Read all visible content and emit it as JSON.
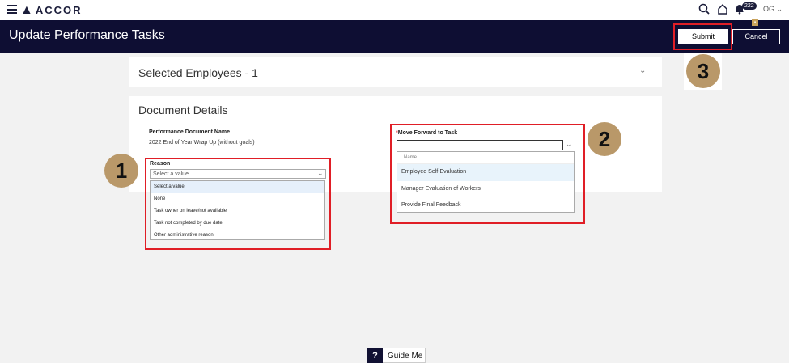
{
  "topbar": {
    "brand": "ACCOR",
    "notification_count": "222",
    "user_initials": "OG"
  },
  "header": {
    "title": "Update Performance Tasks",
    "submit_label": "Submit",
    "cancel_label": "Cancel"
  },
  "steps": [
    "1",
    "2",
    "3"
  ],
  "selected_employees": {
    "title": "Selected Employees - 1"
  },
  "document_details": {
    "title": "Document Details",
    "doc_name_label": "Performance Document Name",
    "doc_name_value": "2022 End of Year Wrap Up (without goals)",
    "reason": {
      "label": "Reason",
      "placeholder": "Select a value",
      "options": [
        "Select a value",
        "None",
        "Task owner on leave/not available",
        "Task not completed by due date",
        "Other administrative reason"
      ]
    },
    "move_forward": {
      "required_marker": "*",
      "label": "Move Forward to Task",
      "column_header": "Name",
      "options": [
        "Employee Self-Evaluation",
        "Manager Evaluation of Workers",
        "Provide Final Feedback"
      ]
    }
  },
  "guide": {
    "icon": "?",
    "label": "Guide Me"
  },
  "colors": {
    "header_bg": "#0e0e33",
    "highlight": "#e01e26",
    "step_badge": "#b99869"
  }
}
